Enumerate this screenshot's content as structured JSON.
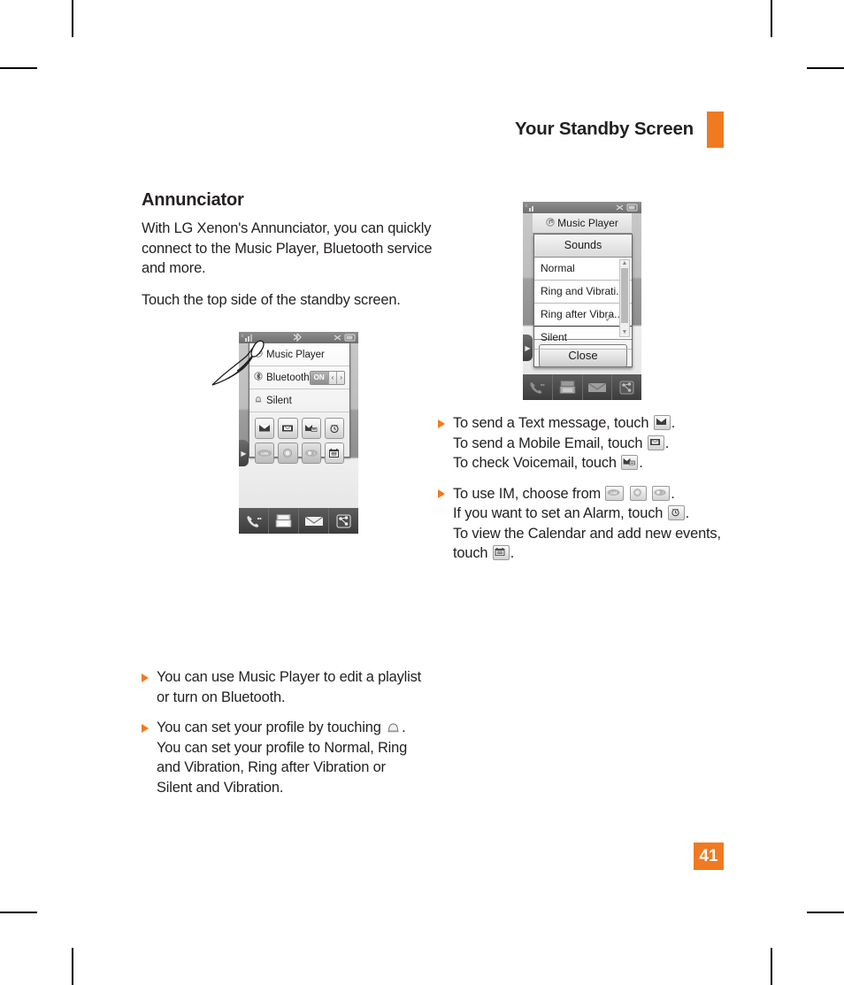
{
  "header": {
    "title": "Your Standby Screen",
    "accent_color": "#f07a20"
  },
  "page_number": "41",
  "left_column": {
    "section_title": "Annunciator",
    "paragraphs": [
      "With LG Xenon's Annunciator, you can quickly connect to the Music Player, Bluetooth service and more.",
      "Touch the top side of the standby screen."
    ],
    "bullets": [
      "You can use Music Player to edit a playlist or turn on Bluetooth.",
      "You can set your profile by touching ",
      "You can set your profile to Normal, Ring and Vibration, Ring after Vibration or Silent and Vibration."
    ],
    "bullet2_line1_a": "You can set your profile by touching",
    "bullet2_line1_b": ".",
    "bullet2_line2": "You can set your profile to Normal, Ring",
    "bullet2_line3": "and Vibration, Ring after Vibration or",
    "bullet2_line4": "Silent and Vibration.",
    "phone": {
      "status_icons": [
        "signal-icon",
        "bluetooth-icon",
        "mute-icon",
        "battery-icon"
      ],
      "rows": [
        {
          "label": "Music Player",
          "icon": "music-note-icon"
        },
        {
          "label": "Bluetooth",
          "icon": "bluetooth-icon",
          "toggle": "ON",
          "toggle_left": "‹",
          "toggle_right": "›"
        },
        {
          "label": "Silent",
          "icon": "bell-icon"
        }
      ],
      "grid_icons": [
        "text-message-icon",
        "mobile-email-icon",
        "voicemail-icon",
        "alarm-clock-icon",
        "aim-icon",
        "windows-live-icon",
        "yahoo-messenger-icon",
        "calendar-icon"
      ],
      "grid_labels": [
        "",
        "",
        "",
        "",
        "AIM",
        "",
        "",
        ""
      ],
      "dock_icons": [
        "dialer-icon",
        "contacts-icon",
        "messages-icon",
        "menu-icon"
      ],
      "gesture": "finger-touch-hand"
    }
  },
  "right_column": {
    "phone": {
      "title_bar": {
        "label": "Music Player",
        "icon": "music-note-icon"
      },
      "dialog": {
        "title": "Sounds",
        "items": [
          {
            "label": "Normal",
            "checked": false
          },
          {
            "label": "Ring and Vibrati...",
            "checked": false
          },
          {
            "label": "Ring after Vibra...",
            "checked": true
          },
          {
            "label": "Silent",
            "checked": false
          }
        ],
        "close_label": "Close",
        "scrollbar": {
          "up": "▲",
          "down": "▼"
        }
      },
      "dock_icons": [
        "dialer-icon",
        "contacts-icon",
        "messages-icon",
        "menu-icon"
      ],
      "status_icons": [
        "signal-icon",
        "mute-icon",
        "battery-icon"
      ]
    },
    "bullets": [
      {
        "lines": [
          {
            "text_before": "To send a Text message, touch",
            "icon": "text-message-icon",
            "text_after": "."
          },
          {
            "text_before": "To send a Mobile Email, touch",
            "icon": "mobile-email-icon",
            "text_after": "."
          },
          {
            "text_before": "To check Voicemail, touch",
            "icon": "voicemail-icon",
            "text_after": "."
          }
        ]
      },
      {
        "lines": [
          {
            "text_before": "To use IM, choose from",
            "icons": [
              "aim-icon",
              "windows-live-icon",
              "yahoo-messenger-icon"
            ],
            "text_after": "."
          },
          {
            "text_before": "If you want to set an Alarm, touch",
            "icon": "alarm-clock-icon",
            "text_after": "."
          },
          {
            "text_before": "To view the Calendar and add new events,",
            "icon": "",
            "text_after": ""
          },
          {
            "text_before": "touch",
            "icon": "calendar-icon",
            "text_after": "."
          }
        ]
      }
    ]
  }
}
